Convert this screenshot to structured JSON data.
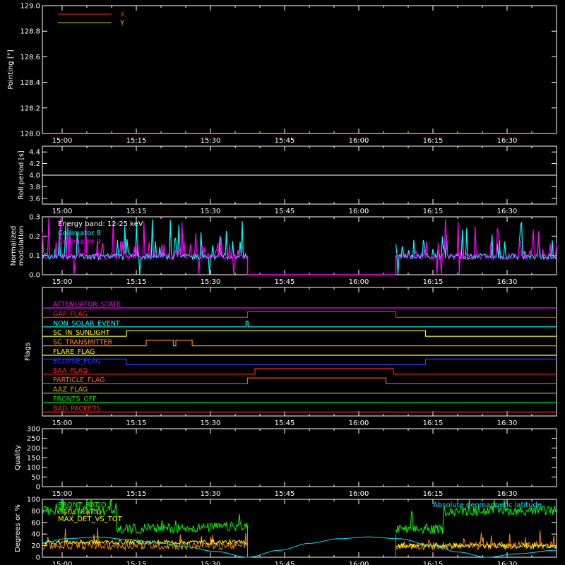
{
  "time_axis": {
    "start_min": 896,
    "end_min": 1000,
    "ticks": [
      "15:00",
      "15:15",
      "15:30",
      "15:45",
      "16:00",
      "16:15",
      "16:30"
    ]
  },
  "panels": {
    "pointing": {
      "ylabel": "Pointing [°]",
      "ylim": [
        128.0,
        129.0
      ],
      "yticks": [
        "128.0",
        "128.2",
        "128.4",
        "128.6",
        "128.8",
        "129.0"
      ],
      "legend": [
        {
          "name": "X",
          "color": "#ff2020"
        },
        {
          "name": "Y",
          "color": "#c8c800"
        }
      ]
    },
    "roll": {
      "ylabel": "Roll period [s]",
      "ylim": [
        3.5,
        4.5
      ],
      "yticks": [
        "3.6",
        "3.8",
        "4.0",
        "4.2",
        "4.4"
      ],
      "value": 4.0
    },
    "modulation": {
      "ylabel_line1": "Normalized",
      "ylabel_line2": "modulation",
      "ylim": [
        0,
        0.3
      ],
      "yticks": [
        "0.0",
        "0.1",
        "0.2",
        "0.3"
      ],
      "energy_band": "Energy band: 12-25 keV",
      "legend": [
        {
          "name": "Collimator 8",
          "color": "#00ffff"
        },
        {
          "name": "Collimator 9",
          "color": "#ff00ff"
        }
      ]
    },
    "flags": {
      "ylabel": "Flags",
      "items": [
        {
          "name": "ATTENUATOR_STATE",
          "color": "#ff00ff",
          "segments": []
        },
        {
          "name": "GAP_FLAG",
          "color": "#ff2020",
          "segments": [
            [
              937.5,
              967.5
            ]
          ]
        },
        {
          "name": "NON_SOLAR_EVENT",
          "color": "#00ffff",
          "segments": [
            [
              937.2,
              937.6
            ]
          ]
        },
        {
          "name": "SC_IN_SUNLIGHT",
          "color": "#ffff00",
          "segments": [
            [
              913.0,
              973.5
            ]
          ]
        },
        {
          "name": "SC_TRANSMITTER",
          "color": "#ff8800",
          "segments": [
            [
              917.0,
              922.5
            ],
            [
              923.0,
              926.3
            ]
          ]
        },
        {
          "name": "FLARE_FLAG",
          "color": "#ffff00",
          "segments": []
        },
        {
          "name": "ECLIPSE_FLAG",
          "color": "#2040ff",
          "segments": [
            [
              913.0,
              973.5
            ]
          ],
          "inverted": true
        },
        {
          "name": "SAA_FLAG",
          "color": "#ff2020",
          "segments": [
            [
              939.0,
              967.0
            ]
          ]
        },
        {
          "name": "PARTICLE_FLAG",
          "color": "#ff6020",
          "segments": [
            [
              937.5,
              965.5
            ]
          ]
        },
        {
          "name": "AAZ_FLAG",
          "color": "#b8b800",
          "segments": []
        },
        {
          "name": "FRONTS_OFF",
          "color": "#00dd00",
          "segments": []
        },
        {
          "name": "BAD_PACKETS",
          "color": "#ff2020",
          "segments": []
        }
      ]
    },
    "quality": {
      "ylabel": "Quality",
      "ylim": [
        0,
        300
      ],
      "yticks": [
        "0",
        "50",
        "100",
        "150",
        "200",
        "250",
        "300"
      ]
    },
    "bottom": {
      "ylabel": "Degrees or %",
      "ylim": [
        0,
        100
      ],
      "yticks": [
        "0",
        "20",
        "40",
        "60",
        "80",
        "100"
      ],
      "legend": [
        {
          "name": "FRONT_RATIO",
          "color": "#00ff00"
        },
        {
          "name": "BACK_RATIO",
          "color": "#ff8800"
        },
        {
          "name": "MAX_DET_VS_TOT",
          "color": "#ffff00"
        }
      ],
      "latitude_label": "Absolute geomagnetic latitude",
      "latitude_color": "#00e5ff"
    }
  },
  "chart_data": [
    {
      "type": "line",
      "title": "",
      "xlabel": "",
      "ylabel": "Pointing [°]",
      "x_range": [
        "14:56",
        "16:40"
      ],
      "ylim": [
        128.0,
        129.0
      ],
      "grid": false,
      "legend_placement": "top-left",
      "series": [
        {
          "name": "X",
          "values": [
            128.0,
            128.0
          ]
        },
        {
          "name": "Y",
          "values": [
            128.0,
            128.0
          ]
        }
      ],
      "x": [
        "14:56",
        "16:40"
      ]
    },
    {
      "type": "line",
      "ylabel": "Roll period [s]",
      "ylim": [
        3.5,
        4.5
      ],
      "x": [
        "14:56",
        "16:40"
      ],
      "values": [
        4.0,
        4.0
      ]
    },
    {
      "type": "line",
      "ylabel": "Normalized modulation",
      "ylim": [
        0,
        0.3
      ],
      "annotation": "Energy band: 12-25 keV",
      "series": [
        {
          "name": "Collimator 8",
          "typical_value": 0.1,
          "peak": 0.3,
          "active_ranges": [
            [
              "14:56",
              "15:41"
            ],
            [
              "16:12",
              "16:40"
            ]
          ]
        },
        {
          "name": "Collimator 9",
          "typical_value": 0.1,
          "peak": 0.3,
          "active_ranges": [
            [
              "14:56",
              "15:41"
            ],
            [
              "16:12",
              "16:40"
            ]
          ]
        }
      ]
    },
    {
      "type": "line",
      "ylabel": "Flags",
      "series": [
        {
          "name": "GAP_FLAG",
          "on": [
            [
              "15:41",
              "16:11"
            ]
          ]
        },
        {
          "name": "NON_SOLAR_EVENT",
          "on": [
            [
              "15:41",
              "15:41"
            ]
          ]
        },
        {
          "name": "SC_IN_SUNLIGHT",
          "on": [
            [
              "15:17",
              "16:17"
            ]
          ]
        },
        {
          "name": "SC_TRANSMITTER",
          "on": [
            [
              "15:21",
              "15:26"
            ],
            [
              "15:27",
              "15:30"
            ]
          ]
        },
        {
          "name": "ECLIPSE_FLAG",
          "on": [
            [
              "14:56",
              "15:17"
            ],
            [
              "16:17",
              "16:40"
            ]
          ]
        },
        {
          "name": "SAA_FLAG",
          "on": [
            [
              "15:43",
              "16:11"
            ]
          ]
        },
        {
          "name": "PARTICLE_FLAG",
          "on": [
            [
              "15:41",
              "16:09"
            ]
          ]
        }
      ]
    },
    {
      "type": "line",
      "ylabel": "Quality",
      "ylim": [
        0,
        300
      ],
      "values": []
    },
    {
      "type": "line",
      "ylabel": "Degrees or %",
      "ylim": [
        0,
        100
      ],
      "series": [
        {
          "name": "FRONT_RATIO",
          "typical_values": {
            "14:56-15:15": 80,
            "15:15-15:41": 45,
            "16:11-16:20": 45,
            "16:20-16:40": 80
          }
        },
        {
          "name": "BACK_RATIO",
          "typical_value": 20
        },
        {
          "name": "MAX_DET_VS_TOT",
          "typical_value": 25
        },
        {
          "name": "Absolute geomagnetic latitude",
          "points": [
            [
              "14:56",
              25
            ],
            [
              "15:07",
              35
            ],
            [
              "15:25",
              18
            ],
            [
              "15:41",
              0
            ],
            [
              "16:02",
              35
            ],
            [
              "16:26",
              0
            ],
            [
              "16:40",
              8
            ]
          ]
        }
      ]
    }
  ]
}
